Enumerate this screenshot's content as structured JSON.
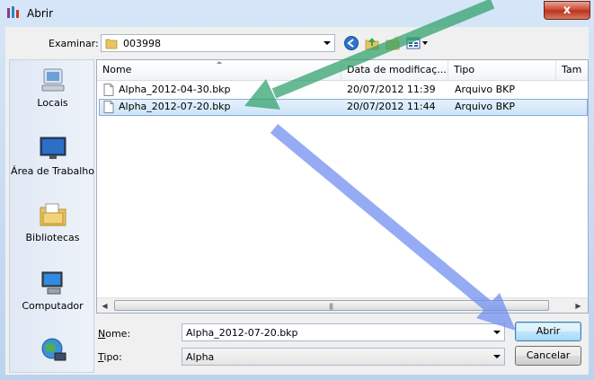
{
  "window": {
    "title": "Abrir",
    "close_glyph": "x"
  },
  "lookin": {
    "label": "Examinar:",
    "value": "003998"
  },
  "toolbar": {
    "icons": [
      "back-icon",
      "up-folder-icon",
      "new-folder-icon",
      "view-menu-icon"
    ]
  },
  "places": [
    {
      "label": "Locais",
      "icon": "recent-places-icon"
    },
    {
      "label": "Área de Trabalho",
      "icon": "desktop-icon"
    },
    {
      "label": "Bibliotecas",
      "icon": "libraries-icon"
    },
    {
      "label": "Computador",
      "icon": "computer-icon"
    },
    {
      "label": "",
      "icon": "network-icon"
    }
  ],
  "filelist": {
    "columns": [
      "Nome",
      "Data de modificaç...",
      "Tipo",
      "Tam"
    ],
    "rows": [
      {
        "name": "Alpha_2012-04-30.bkp",
        "date": "20/07/2012 11:39",
        "type": "Arquivo BKP",
        "selected": false
      },
      {
        "name": "Alpha_2012-07-20.bkp",
        "date": "20/07/2012 11:44",
        "type": "Arquivo BKP",
        "selected": true
      }
    ]
  },
  "filename": {
    "label_underlined": "N",
    "label_rest": "ome:",
    "value": "Alpha_2012-07-20.bkp"
  },
  "filetype": {
    "label_underlined": "T",
    "label_rest": "ipo:",
    "value": "Alpha"
  },
  "buttons": {
    "open": "Abrir",
    "cancel": "Cancelar"
  },
  "colors": {
    "arrow_green": "#2fa06a",
    "arrow_blue": "#6d8df0",
    "selection": "#cde4f8"
  }
}
